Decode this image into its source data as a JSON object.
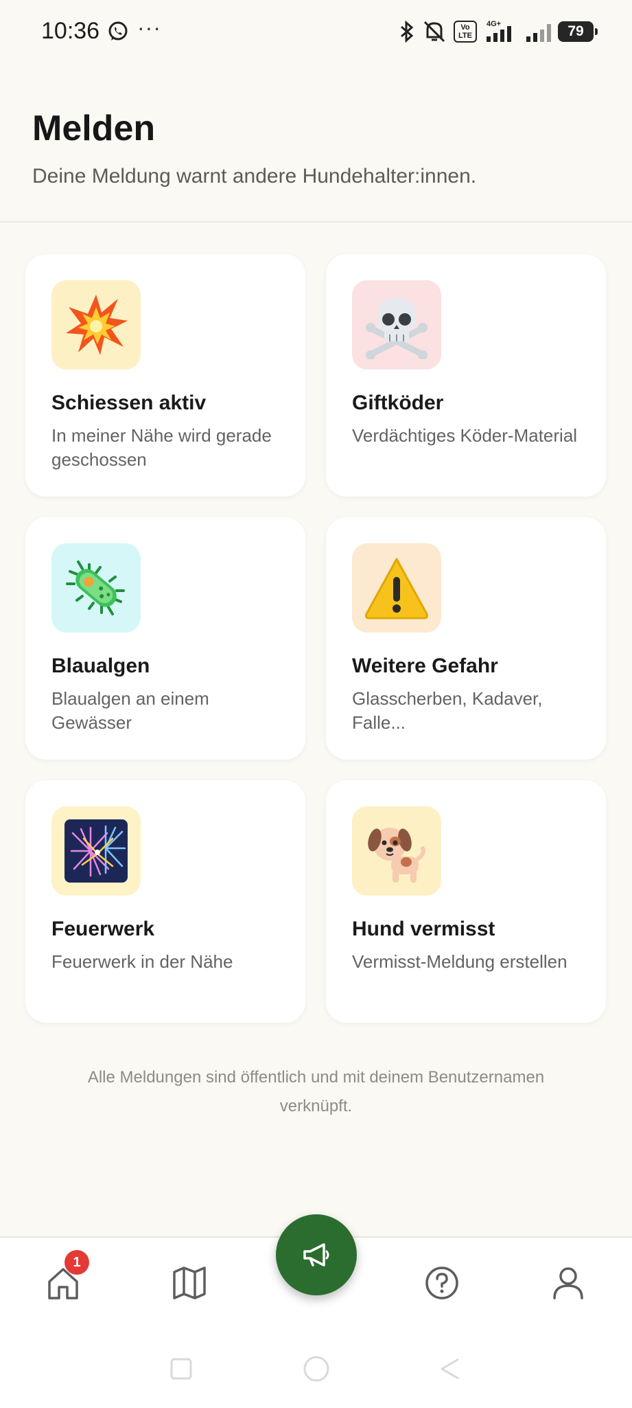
{
  "status_bar": {
    "time": "10:36",
    "network": "4G+",
    "volte": "Vo LTE",
    "battery": "79"
  },
  "header": {
    "title": "Melden",
    "subtitle": "Deine Meldung warnt andere Hundehalter:innen."
  },
  "cards": [
    {
      "title": "Schiessen aktiv",
      "desc": "In meiner Nähe wird gerade geschossen",
      "icon": "explosion-icon",
      "bg": "#fdf0c4"
    },
    {
      "title": "Giftköder",
      "desc": "Verdächtiges Köder-Material",
      "icon": "skull-crossbones-icon",
      "bg": "#fbe1e1"
    },
    {
      "title": "Blaualgen",
      "desc": "Blaualgen an einem Gewässer",
      "icon": "microbe-icon",
      "bg": "#d5f7f8"
    },
    {
      "title": "Weitere Gefahr",
      "desc": "Glasscherben, Kadaver, Falle...",
      "icon": "warning-icon",
      "bg": "#fde9cf"
    },
    {
      "title": "Feuerwerk",
      "desc": "Feuerwerk in der Nähe",
      "icon": "fireworks-icon",
      "bg": "#fdf3c6"
    },
    {
      "title": "Hund vermisst",
      "desc": "Vermisst-Meldung erstellen",
      "icon": "dog-icon",
      "bg": "#fdf0c4"
    }
  ],
  "footnote": "Alle Meldungen sind öffentlich und mit deinem Benutzernamen verknüpft.",
  "bottom_nav": {
    "home_badge": "1",
    "items": [
      "home-icon",
      "map-icon",
      "megaphone-icon",
      "help-icon",
      "profile-icon"
    ],
    "accent": "#2b6d2f"
  }
}
